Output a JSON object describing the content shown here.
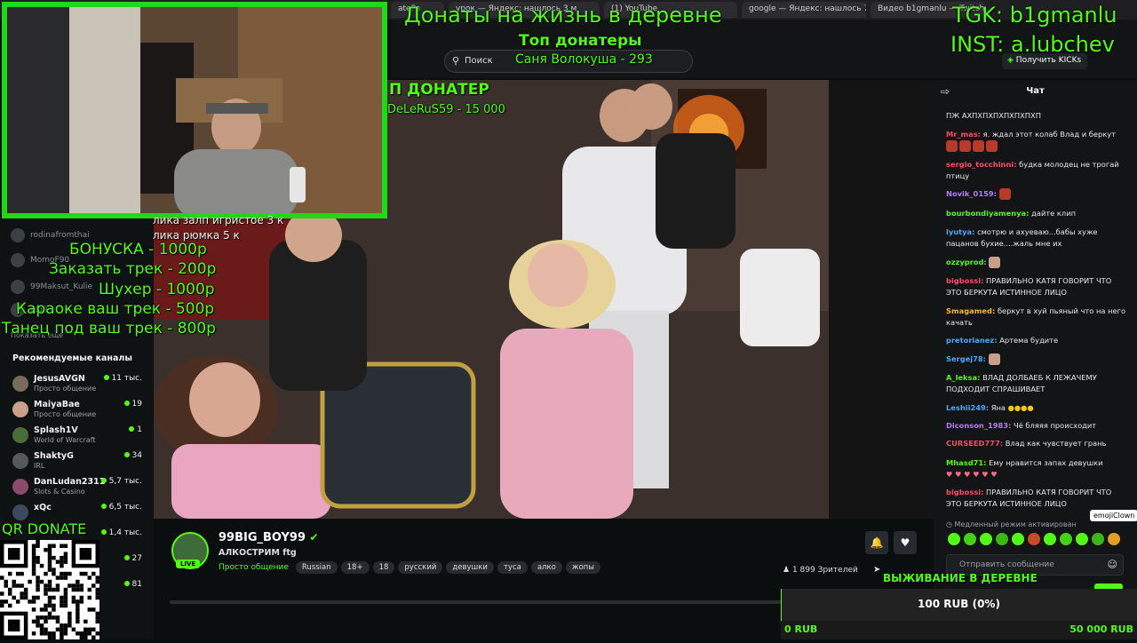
{
  "browser": {
    "tabs": [
      {
        "label": "atePa"
      },
      {
        "label": "урок — Яндекс: нашлось 3 м"
      },
      {
        "label": "(1) YouTube"
      },
      {
        "label": "google — Яндекс: нашлось 7 м"
      },
      {
        "label": "Видео b1gmanlu — Twitch"
      }
    ]
  },
  "header": {
    "search_placeholder": "Поиск",
    "get_kicks_label": "Получить KICKs"
  },
  "overlay": {
    "title": "Донаты на жизнь в деревне",
    "top_donors_label": "Топ донатеры",
    "top_donor_entry": "Саня Волокуша - 293",
    "tgk": "TGK: b1gmanlu",
    "inst": "INST: a.lubchev",
    "top_donater_label": "П ДОНАТЕР",
    "top_donater_value": "DeLeRuS59 - 15 000",
    "price_list_partial": [
      "лика залп игристое 3 к",
      "лика рюмка  5 к"
    ],
    "price_list": [
      "БОНУСКА - 1000р",
      "Заказать трек - 200р",
      "Шухер - 1000р",
      "Караоке ваш трек - 500р",
      "Танец под ваш трек - 800р"
    ],
    "qr_label": "QR DONATE",
    "survival_label": "ВЫЖИВАНИЕ В ДЕРЕВНЕ",
    "donation_goal_current": "100 RUB (0%)",
    "donation_goal_min": "0 RUB",
    "donation_goal_max": "50 000 RUB",
    "donation_goal_progress": 0.002
  },
  "sidebar": {
    "following": [
      {
        "name": "rodinafromthai"
      },
      {
        "name": "MomoF90"
      },
      {
        "name": "99Maksut_Kulie"
      },
      {
        "name": "Ещё"
      }
    ],
    "show_more": "Показать еще",
    "recommended_title": "Рекомендуемые каналы",
    "recommended": [
      {
        "name": "JesusAVGN",
        "category": "Просто общение",
        "viewers": "11 тыс.",
        "color": "#7a6a5c"
      },
      {
        "name": "MaiyaBae",
        "category": "Просто общение",
        "viewers": "19",
        "color": "#c9a08a"
      },
      {
        "name": "Splash1V",
        "category": "World of Warcraft",
        "viewers": "1",
        "color": "#4a6b3a"
      },
      {
        "name": "ShaktyG",
        "category": "IRL",
        "viewers": "34",
        "color": "#55595c"
      },
      {
        "name": "DanLudan2311",
        "category": "Slots & Casino",
        "viewers": "5,7 тыс.",
        "color": "#8a4a6a"
      },
      {
        "name": "xQc",
        "category": "",
        "viewers": "6,5 тыс.",
        "color": "#3a4a5a"
      },
      {
        "name": "",
        "category": "",
        "viewers": "1,4 тыс.",
        "color": "#333"
      },
      {
        "name": "",
        "category": "",
        "viewers": "27",
        "color": "#333"
      },
      {
        "name": "",
        "category": "",
        "viewers": "81",
        "color": "#333"
      }
    ]
  },
  "stream": {
    "channel_name": "99BIG_BOY99",
    "title": "АЛКОСТРИМ ftg",
    "category": "Просто общение",
    "live_badge": "LIVE",
    "tags": [
      "Russian",
      "18+",
      "18",
      "русский",
      "девушки",
      "туса",
      "алко",
      "жопы"
    ],
    "viewers": "1 899 Зрителей"
  },
  "chat": {
    "title": "Чат",
    "messages": [
      {
        "user": "",
        "color": "#ffffff",
        "text": "ПЖ АХПХПХПХПХПХПХП"
      },
      {
        "user": "Mr_mas:",
        "color": "#ff4a6a",
        "text": "я. ждал этот колаб Влад и беркут"
      },
      {
        "user": "sergio_tocchinni:",
        "color": "#ff4a6a",
        "text": "будка молодец не трогай птицу"
      },
      {
        "user": "Novik_0159:",
        "color": "#b57aff",
        "text": ""
      },
      {
        "user": "bourbondiyamenya:",
        "color": "#53fc18",
        "text": "дайте клип"
      },
      {
        "user": "lyutya:",
        "color": "#4aa8ff",
        "text": "смотрю и ахуеваю...бабы хуже пацанов бухие....жаль мне их"
      },
      {
        "user": "ozzyprod:",
        "color": "#53fc18",
        "text": ""
      },
      {
        "user": "bigbossi:",
        "color": "#ff4a6a",
        "text": "ПРАВИЛЬНО КАТЯ ГОВОРИТ ЧТО ЭТО БЕРКУТА ИСТИННОЕ ЛИЦО"
      },
      {
        "user": "Smagamed:",
        "color": "#ffb52a",
        "text": "беркут в хуй пьяный что на него качать"
      },
      {
        "user": "pretorianez:",
        "color": "#4aa8ff",
        "text": "Артема будите"
      },
      {
        "user": "Sergej78:",
        "color": "#4aa8ff",
        "text": ""
      },
      {
        "user": "A_leksa:",
        "color": "#53fc18",
        "text": "ВЛАД ДОЛБАЕБ К ЛЕЖАЧЕМУ ПОДХОДИТ СПРАШИВАЕТ"
      },
      {
        "user": "Leshii249:",
        "color": "#4aa8ff",
        "text": "Яна"
      },
      {
        "user": "Diconson_1983:",
        "color": "#b57aff",
        "text": "Чё бляяя происходит"
      },
      {
        "user": "CURSEED777:",
        "color": "#ff4a6a",
        "text": "Влад как чувствует грань"
      },
      {
        "user": "Mhasd71:",
        "color": "#53fc18",
        "text": "Ему нравится запах девушки"
      },
      {
        "user": "bigbossi:",
        "color": "#ff4a6a",
        "text": "ПРАВИЛЬНО КАТЯ ГОВОРИТ ЧТО ЭТО БЕРКУТА ИСТИННОЕ ЛИЦО"
      }
    ],
    "slow_mode": "Медленный режим активирован",
    "emoji_tooltip": "emojiClown",
    "input_placeholder": "Отправить сообщение"
  },
  "colors": {
    "accent": "#53fc18",
    "overlay_green": "#53fc18",
    "background": "#0b0e0f",
    "chat_background": "#121416"
  }
}
